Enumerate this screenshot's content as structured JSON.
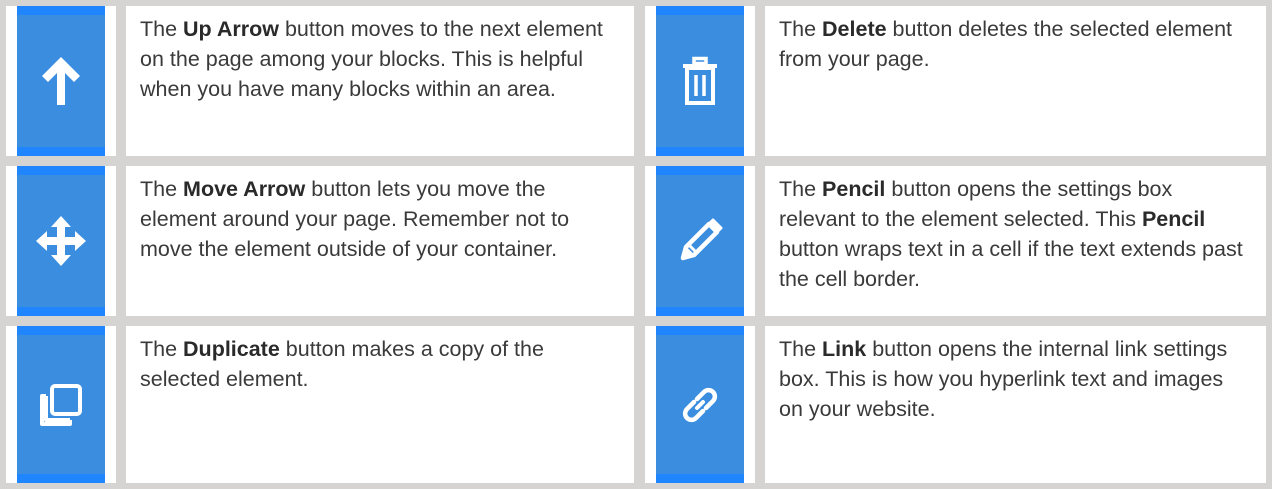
{
  "rows": [
    {
      "left": {
        "icon": "up-arrow-icon",
        "pre": "The ",
        "bold": "Up Arrow",
        "post": " button moves to the next element on the page among your blocks. This is helpful when you have many blocks within an area."
      },
      "right": {
        "icon": "trash-icon",
        "pre": "The ",
        "bold": "Delete",
        "post": " button deletes the selected element from your page."
      }
    },
    {
      "left": {
        "icon": "move-arrows-icon",
        "pre": "The ",
        "bold": "Move Arrow",
        "post": " button lets you move the element around your page. Remember not to move the element outside of your container."
      },
      "right": {
        "icon": "pencil-icon",
        "pre": "The ",
        "bold": "Pencil",
        "post": " button opens the settings box relevant to the element selected.",
        "pre2": " This ",
        "bold2": "Pencil",
        "post2": " button wraps text in a cell if the text extends past the cell border."
      }
    },
    {
      "left": {
        "icon": "duplicate-icon",
        "pre": "The ",
        "bold": "Duplicate",
        "post": " button makes a copy of the selected element."
      },
      "right": {
        "icon": "link-icon",
        "pre": "The ",
        "bold": "Link",
        "post": " button opens the internal link settings box. This is how you hyperlink text and images on your website."
      }
    }
  ],
  "colors": {
    "border": "#d6d3d3",
    "icon_bg": "#3a8ddf",
    "icon_band": "#1f86ff",
    "icon_glyph": "#ffffff",
    "text": "#3a3a3a"
  }
}
